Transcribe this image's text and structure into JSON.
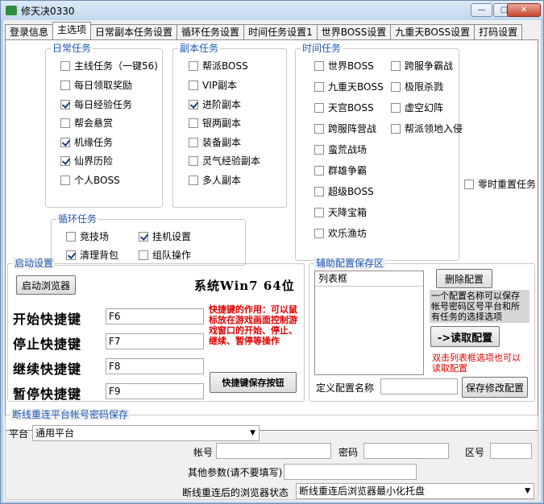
{
  "window": {
    "title": "修天决0330",
    "controls": {
      "minimize": "—",
      "restore": "▢",
      "close": "✕"
    }
  },
  "tabs": [
    "登录信息",
    "主选项",
    "日常副本任务设置",
    "循环任务设置",
    "时间任务设置1",
    "世界BOSS设置",
    "九重天BOSS设置",
    "打码设置"
  ],
  "active_tab": "主选项",
  "daily": {
    "legend": "日常任务",
    "items": [
      {
        "label": "主线任务（一键56)",
        "checked": false
      },
      {
        "label": "每日领取奖励",
        "checked": false
      },
      {
        "label": "每日经验任务",
        "checked": true
      },
      {
        "label": "帮会悬赏",
        "checked": false
      },
      {
        "label": "机缘任务",
        "checked": true
      },
      {
        "label": "仙界历险",
        "checked": true
      },
      {
        "label": "个人BOSS",
        "checked": false
      }
    ]
  },
  "dungeon": {
    "legend": "副本任务",
    "items": [
      {
        "label": "帮派BOSS",
        "checked": false
      },
      {
        "label": "VIP副本",
        "checked": false
      },
      {
        "label": "进阶副本",
        "checked": true
      },
      {
        "label": "银两副本",
        "checked": false
      },
      {
        "label": "装备副本",
        "checked": false
      },
      {
        "label": "灵气经验副本",
        "checked": false
      },
      {
        "label": "多人副本",
        "checked": false
      }
    ]
  },
  "timed": {
    "legend": "时间任务",
    "left": [
      {
        "label": "世界BOSS",
        "checked": false
      },
      {
        "label": "九重天BOSS",
        "checked": false
      },
      {
        "label": "天宫BOSS",
        "checked": false
      },
      {
        "label": "跨服阵营战",
        "checked": false
      },
      {
        "label": "蛮荒战场",
        "checked": false
      },
      {
        "label": "群雄争霸",
        "checked": false
      },
      {
        "label": "超级BOSS",
        "checked": false
      },
      {
        "label": "天降宝箱",
        "checked": false
      },
      {
        "label": "欢乐渔坊",
        "checked": false
      }
    ],
    "right": [
      {
        "label": "跨服争霸战",
        "checked": false
      },
      {
        "label": "极限杀戮",
        "checked": false
      },
      {
        "label": "虚空幻阵",
        "checked": false
      },
      {
        "label": "帮派领地入侵",
        "checked": false
      }
    ]
  },
  "midnight_reset": {
    "label": "零时重置任务",
    "checked": false
  },
  "loop": {
    "legend": "循环任务",
    "items": [
      {
        "label": "竞技场",
        "checked": false
      },
      {
        "label": "挂机设置",
        "checked": true
      },
      {
        "label": "清理背包",
        "checked": true
      },
      {
        "label": "组队操作",
        "checked": false
      }
    ]
  },
  "startup": {
    "legend": "启动设置",
    "launch_button": "启动浏览器",
    "system_text": "系统Win7 64位",
    "hotkeys": [
      {
        "label": "开始快捷键",
        "value": "F6"
      },
      {
        "label": "停止快捷键",
        "value": "F7"
      },
      {
        "label": "继续快捷键",
        "value": "F8"
      },
      {
        "label": "暂停快捷键",
        "value": "F9"
      }
    ],
    "hotkey_note": "快捷键的作用：可以鼠标放在游戏画面控制游戏窗口的开始、停止、继续、暂停等操作",
    "save_hotkey_button": "快捷键保存按钮"
  },
  "config": {
    "legend": "辅助配置保存区",
    "list_header": "列表框",
    "delete_button": "删除配置",
    "description": "一个配置名称可以保存帐号密码区号平台和所有任务的选择选项",
    "read_button": "->读取配置",
    "double_click_note": "双击列表框选项也可以读取配置",
    "name_label": "定义配置名称",
    "name_value": "",
    "save_button": "保存修改配置"
  },
  "reconnect": {
    "legend": "断线重连平台帐号密码保存",
    "platform_label": "平台",
    "platform_value": "通用平台",
    "account_label": "帐号",
    "password_label": "密码",
    "zone_label": "区号",
    "other_label": "其他参数(请不要填写)",
    "browser_state_label": "断线重连后的浏览器状态",
    "browser_state_value": "断线重连后浏览器最小化托盘"
  }
}
